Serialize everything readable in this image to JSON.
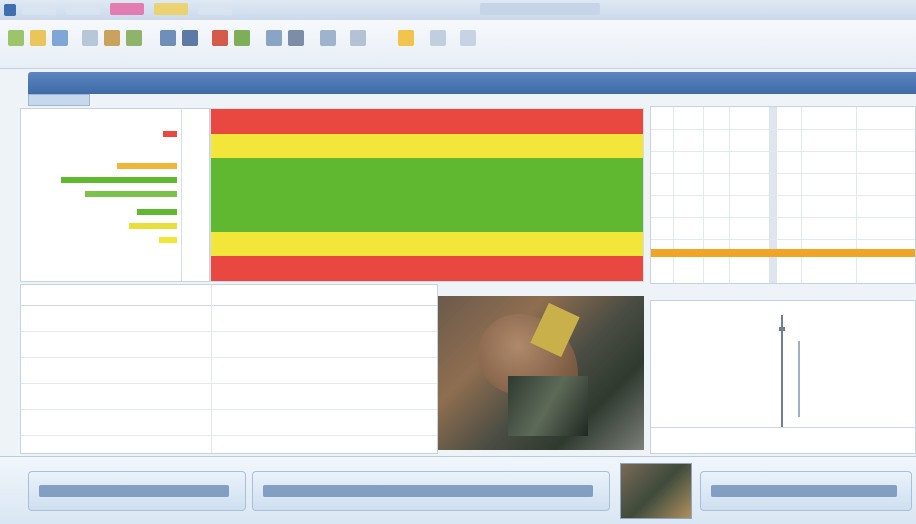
{
  "colors": {
    "red": "#e8483f",
    "yellow": "#f3e63a",
    "green": "#5fb830",
    "orange": "#f0a526",
    "blue": "#3f6aa6"
  },
  "toolbar": {
    "buttons": [
      {
        "icon": "new-icon"
      },
      {
        "icon": "open-icon"
      },
      {
        "icon": "save-icon"
      },
      {
        "icon": "cut-icon"
      },
      {
        "icon": "copy-icon"
      },
      {
        "icon": "paste-icon"
      },
      {
        "icon": "undo-icon"
      },
      {
        "icon": "redo-icon"
      },
      {
        "icon": "filter-icon"
      },
      {
        "icon": "chart-icon"
      },
      {
        "icon": "table-icon"
      },
      {
        "icon": "settings-icon"
      },
      {
        "icon": "help-icon"
      }
    ]
  },
  "heatmap": {
    "bands": [
      "red",
      "yellow",
      "green",
      "green",
      "green",
      "yellow",
      "red"
    ]
  },
  "taskbar": {
    "items": [
      {
        "icon": "document-icon"
      },
      {
        "icon": "window-icon"
      },
      {
        "icon": "photo-icon"
      },
      {
        "icon": "window-icon"
      }
    ]
  }
}
